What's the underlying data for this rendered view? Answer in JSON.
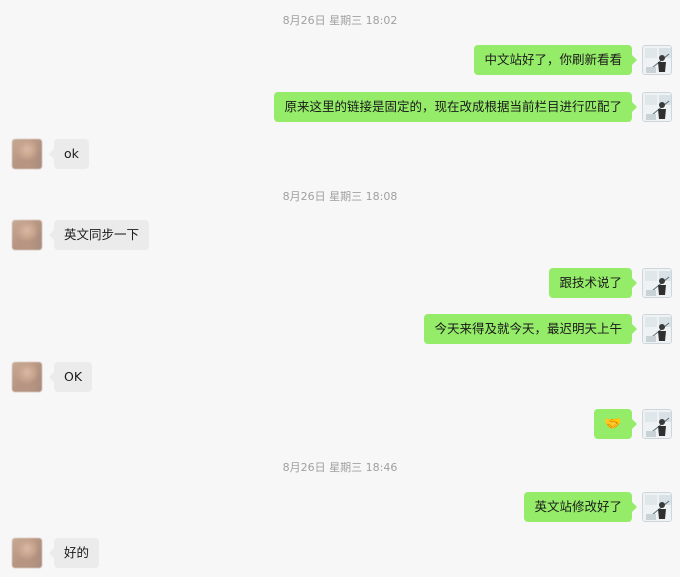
{
  "timestamps": [
    "8月26日 星期三 18:02",
    "8月26日 星期三 18:08",
    "8月26日 星期三 18:46"
  ],
  "messages": [
    {
      "from": "me",
      "text": "中文站好了，你刷新看看"
    },
    {
      "from": "me",
      "text": "原来这里的链接是固定的，现在改成根据当前栏目进行匹配了"
    },
    {
      "from": "other",
      "text": "ok"
    },
    {
      "from": "other",
      "text": "英文同步一下"
    },
    {
      "from": "me",
      "text": "跟技术说了"
    },
    {
      "from": "me",
      "text": "今天来得及就今天，最迟明天上午"
    },
    {
      "from": "other",
      "text": "OK"
    },
    {
      "from": "me",
      "text": "🤝",
      "icon": "handshake-emoji"
    },
    {
      "from": "me",
      "text": "英文站修改好了"
    },
    {
      "from": "other",
      "text": "好的"
    }
  ],
  "colors": {
    "background": "#f7f7f7",
    "outgoing_bubble": "#95ec69",
    "incoming_bubble": "#ebebeb",
    "timestamp_text": "#a0a0a0"
  }
}
